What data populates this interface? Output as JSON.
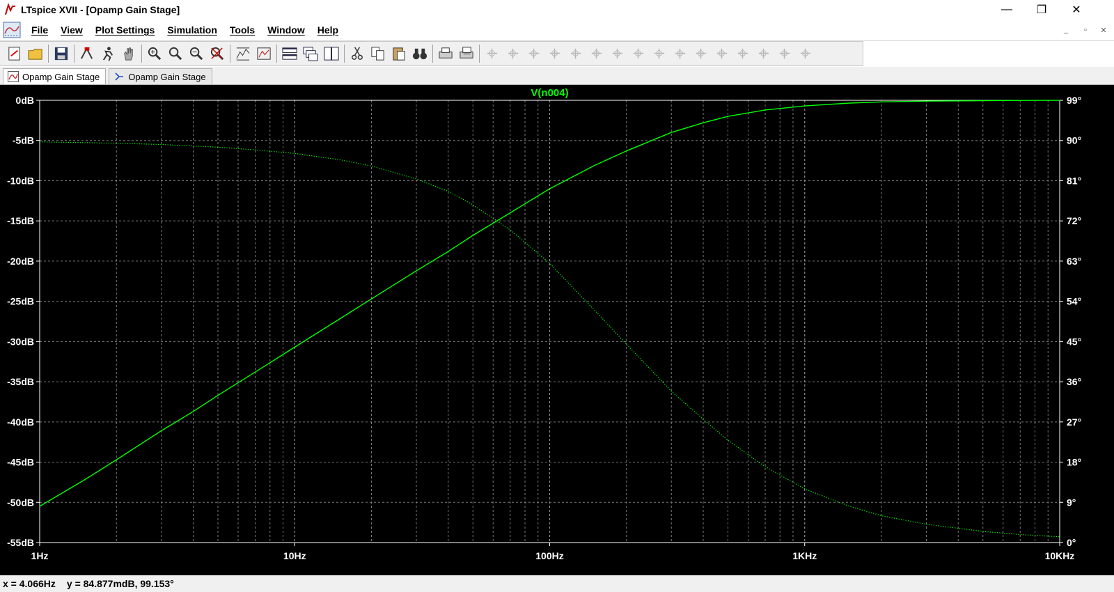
{
  "window": {
    "title": "LTspice XVII - [Opamp Gain Stage]",
    "controls": {
      "minimize": "—",
      "restore": "❐",
      "close": "✕"
    }
  },
  "menu": {
    "items": [
      "File",
      "View",
      "Plot Settings",
      "Simulation",
      "Tools",
      "Window",
      "Help"
    ],
    "mdi_controls": [
      "_",
      "▫",
      "✕"
    ]
  },
  "toolbar": {
    "groups": [
      [
        "new-schematic-icon",
        "open-icon"
      ],
      [
        "save-icon"
      ],
      [
        "control-panel-icon",
        "run-icon",
        "halt-icon"
      ],
      [
        "zoom-area-icon",
        "zoom-in-icon",
        "zoom-out-icon",
        "zoom-cancel-icon"
      ],
      [
        "autorange-icon",
        "plot-settings-icon"
      ],
      [
        "tile-horizontal-icon",
        "cascade-icon",
        "tile-vertical-icon"
      ],
      [
        "cut-icon",
        "copy-icon",
        "paste-icon",
        "find-icon"
      ],
      [
        "print-icon",
        "print-preview-icon"
      ],
      [
        "wire-icon",
        "ground-icon",
        "label-icon",
        "resistor-icon",
        "capacitor-icon",
        "inductor-icon",
        "diode-icon",
        "component-icon",
        "move-icon",
        "drag-icon",
        "undo-icon",
        "redo-icon",
        "rotate-icon",
        "mirror-icon",
        "text-icon",
        "spice-directive-icon"
      ]
    ]
  },
  "tabs": [
    {
      "label": "Opamp Gain Stage",
      "icon": "waveform-icon",
      "active": true
    },
    {
      "label": "Opamp Gain Stage",
      "icon": "schematic-icon",
      "active": false
    }
  ],
  "chart_data": {
    "type": "line",
    "title": "V(n004)",
    "x_scale": "log",
    "xlim": [
      1,
      10000
    ],
    "x_ticks": [
      "1Hz",
      "10Hz",
      "100Hz",
      "1KHz",
      "10KHz"
    ],
    "ylim": [
      -55,
      0
    ],
    "y_ticks": [
      "0dB",
      "-5dB",
      "-10dB",
      "-15dB",
      "-20dB",
      "-25dB",
      "-30dB",
      "-35dB",
      "-40dB",
      "-45dB",
      "-50dB",
      "-55dB"
    ],
    "y2lim": [
      0,
      99
    ],
    "y2_ticks": [
      "99°",
      "90°",
      "81°",
      "72°",
      "63°",
      "54°",
      "45°",
      "36°",
      "27°",
      "18°",
      "9°",
      "0°"
    ],
    "grid": true,
    "colors": {
      "background": "#000000",
      "trace": "#00ff00",
      "grid": "#9a9a9a",
      "axis_text": "#ffffff",
      "title": "#00ff00"
    },
    "series": [
      {
        "axis": "magnitude_dB",
        "style": "solid",
        "x": [
          1,
          1.5,
          2,
          3,
          4,
          5,
          7,
          10,
          15,
          20,
          30,
          40,
          50,
          70,
          100,
          150,
          200,
          300,
          400,
          500,
          700,
          1000,
          1500,
          2000,
          3000,
          5000,
          7000,
          10000
        ],
        "y": [
          -50.5,
          -47.2,
          -44.7,
          -41.1,
          -38.7,
          -36.7,
          -33.8,
          -30.7,
          -27.2,
          -24.7,
          -21.2,
          -18.8,
          -16.8,
          -14.0,
          -11.0,
          -8.1,
          -6.3,
          -4.0,
          -2.8,
          -2.0,
          -1.2,
          -0.7,
          -0.35,
          -0.2,
          -0.1,
          -0.05,
          -0.02,
          -0.01
        ]
      },
      {
        "axis": "phase_deg",
        "style": "dotted",
        "x": [
          1,
          2,
          3,
          5,
          7,
          10,
          15,
          20,
          30,
          40,
          50,
          70,
          100,
          150,
          200,
          300,
          400,
          500,
          700,
          1000,
          1500,
          2000,
          3000,
          5000,
          7000,
          10000
        ],
        "y": [
          89.7,
          89.4,
          89.1,
          88.5,
          87.9,
          87.1,
          85.7,
          84.3,
          81.4,
          78.6,
          75.6,
          70.0,
          62.5,
          52.0,
          44.4,
          33.9,
          27.6,
          22.9,
          17.0,
          12.0,
          8.1,
          6.0,
          4.1,
          2.5,
          1.8,
          1.3
        ]
      }
    ]
  },
  "status": {
    "x_readout": "x = 4.066Hz",
    "y_readout": "y = 84.877mdB, 99.153°"
  }
}
